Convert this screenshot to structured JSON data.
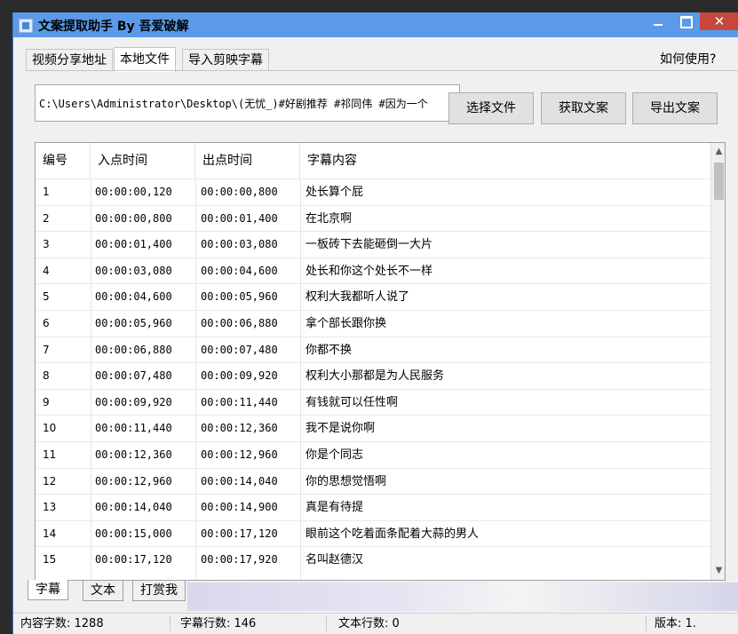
{
  "window": {
    "title": "文案提取助手 By 吾爱破解",
    "close_label": "✕"
  },
  "tabs": [
    {
      "label": "视频分享地址"
    },
    {
      "label": "本地文件"
    },
    {
      "label": "导入剪映字幕"
    }
  ],
  "help_label": "如何使用?",
  "path_value": "C:\\Users\\Administrator\\Desktop\\(无忧_)#好剧推荐 #祁同伟 #因为一个",
  "buttons": {
    "select_file": "选择文件",
    "get_text": "获取文案",
    "export_text": "导出文案"
  },
  "table": {
    "columns": [
      "编号",
      "入点时间",
      "出点时间",
      "字幕内容"
    ],
    "rows": [
      {
        "no": "1",
        "start": "00:00:00,120",
        "end": "00:00:00,800",
        "text": "处长算个屁"
      },
      {
        "no": "2",
        "start": "00:00:00,800",
        "end": "00:00:01,400",
        "text": "在北京啊"
      },
      {
        "no": "3",
        "start": "00:00:01,400",
        "end": "00:00:03,080",
        "text": "一板砖下去能砸倒一大片"
      },
      {
        "no": "4",
        "start": "00:00:03,080",
        "end": "00:00:04,600",
        "text": "处长和你这个处长不一样"
      },
      {
        "no": "5",
        "start": "00:00:04,600",
        "end": "00:00:05,960",
        "text": "权利大我都听人说了"
      },
      {
        "no": "6",
        "start": "00:00:05,960",
        "end": "00:00:06,880",
        "text": "拿个部长跟你换"
      },
      {
        "no": "7",
        "start": "00:00:06,880",
        "end": "00:00:07,480",
        "text": "你都不换"
      },
      {
        "no": "8",
        "start": "00:00:07,480",
        "end": "00:00:09,920",
        "text": "权利大小那都是为人民服务"
      },
      {
        "no": "9",
        "start": "00:00:09,920",
        "end": "00:00:11,440",
        "text": "有钱就可以任性啊"
      },
      {
        "no": "10",
        "start": "00:00:11,440",
        "end": "00:00:12,360",
        "text": "我不是说你啊"
      },
      {
        "no": "11",
        "start": "00:00:12,360",
        "end": "00:00:12,960",
        "text": "你是个同志"
      },
      {
        "no": "12",
        "start": "00:00:12,960",
        "end": "00:00:14,040",
        "text": "你的思想觉悟啊"
      },
      {
        "no": "13",
        "start": "00:00:14,040",
        "end": "00:00:14,900",
        "text": "真是有待提"
      },
      {
        "no": "14",
        "start": "00:00:15,000",
        "end": "00:00:17,120",
        "text": "眼前这个吃着面条配着大蒜的男人"
      },
      {
        "no": "15",
        "start": "00:00:17,120",
        "end": "00:00:17,920",
        "text": "名叫赵德汉"
      }
    ]
  },
  "bottom_tabs": [
    {
      "label": "字幕"
    },
    {
      "label": "文本"
    },
    {
      "label": "打赏我"
    }
  ],
  "status": {
    "content_chars": "内容字数: 1288",
    "subtitle_lines": "字幕行数: 146",
    "text_lines": "文本行数: 0",
    "version": "版本: 1."
  },
  "icons": {
    "scroll_up": "up-arrow-icon",
    "scroll_down": "down-arrow-icon"
  }
}
